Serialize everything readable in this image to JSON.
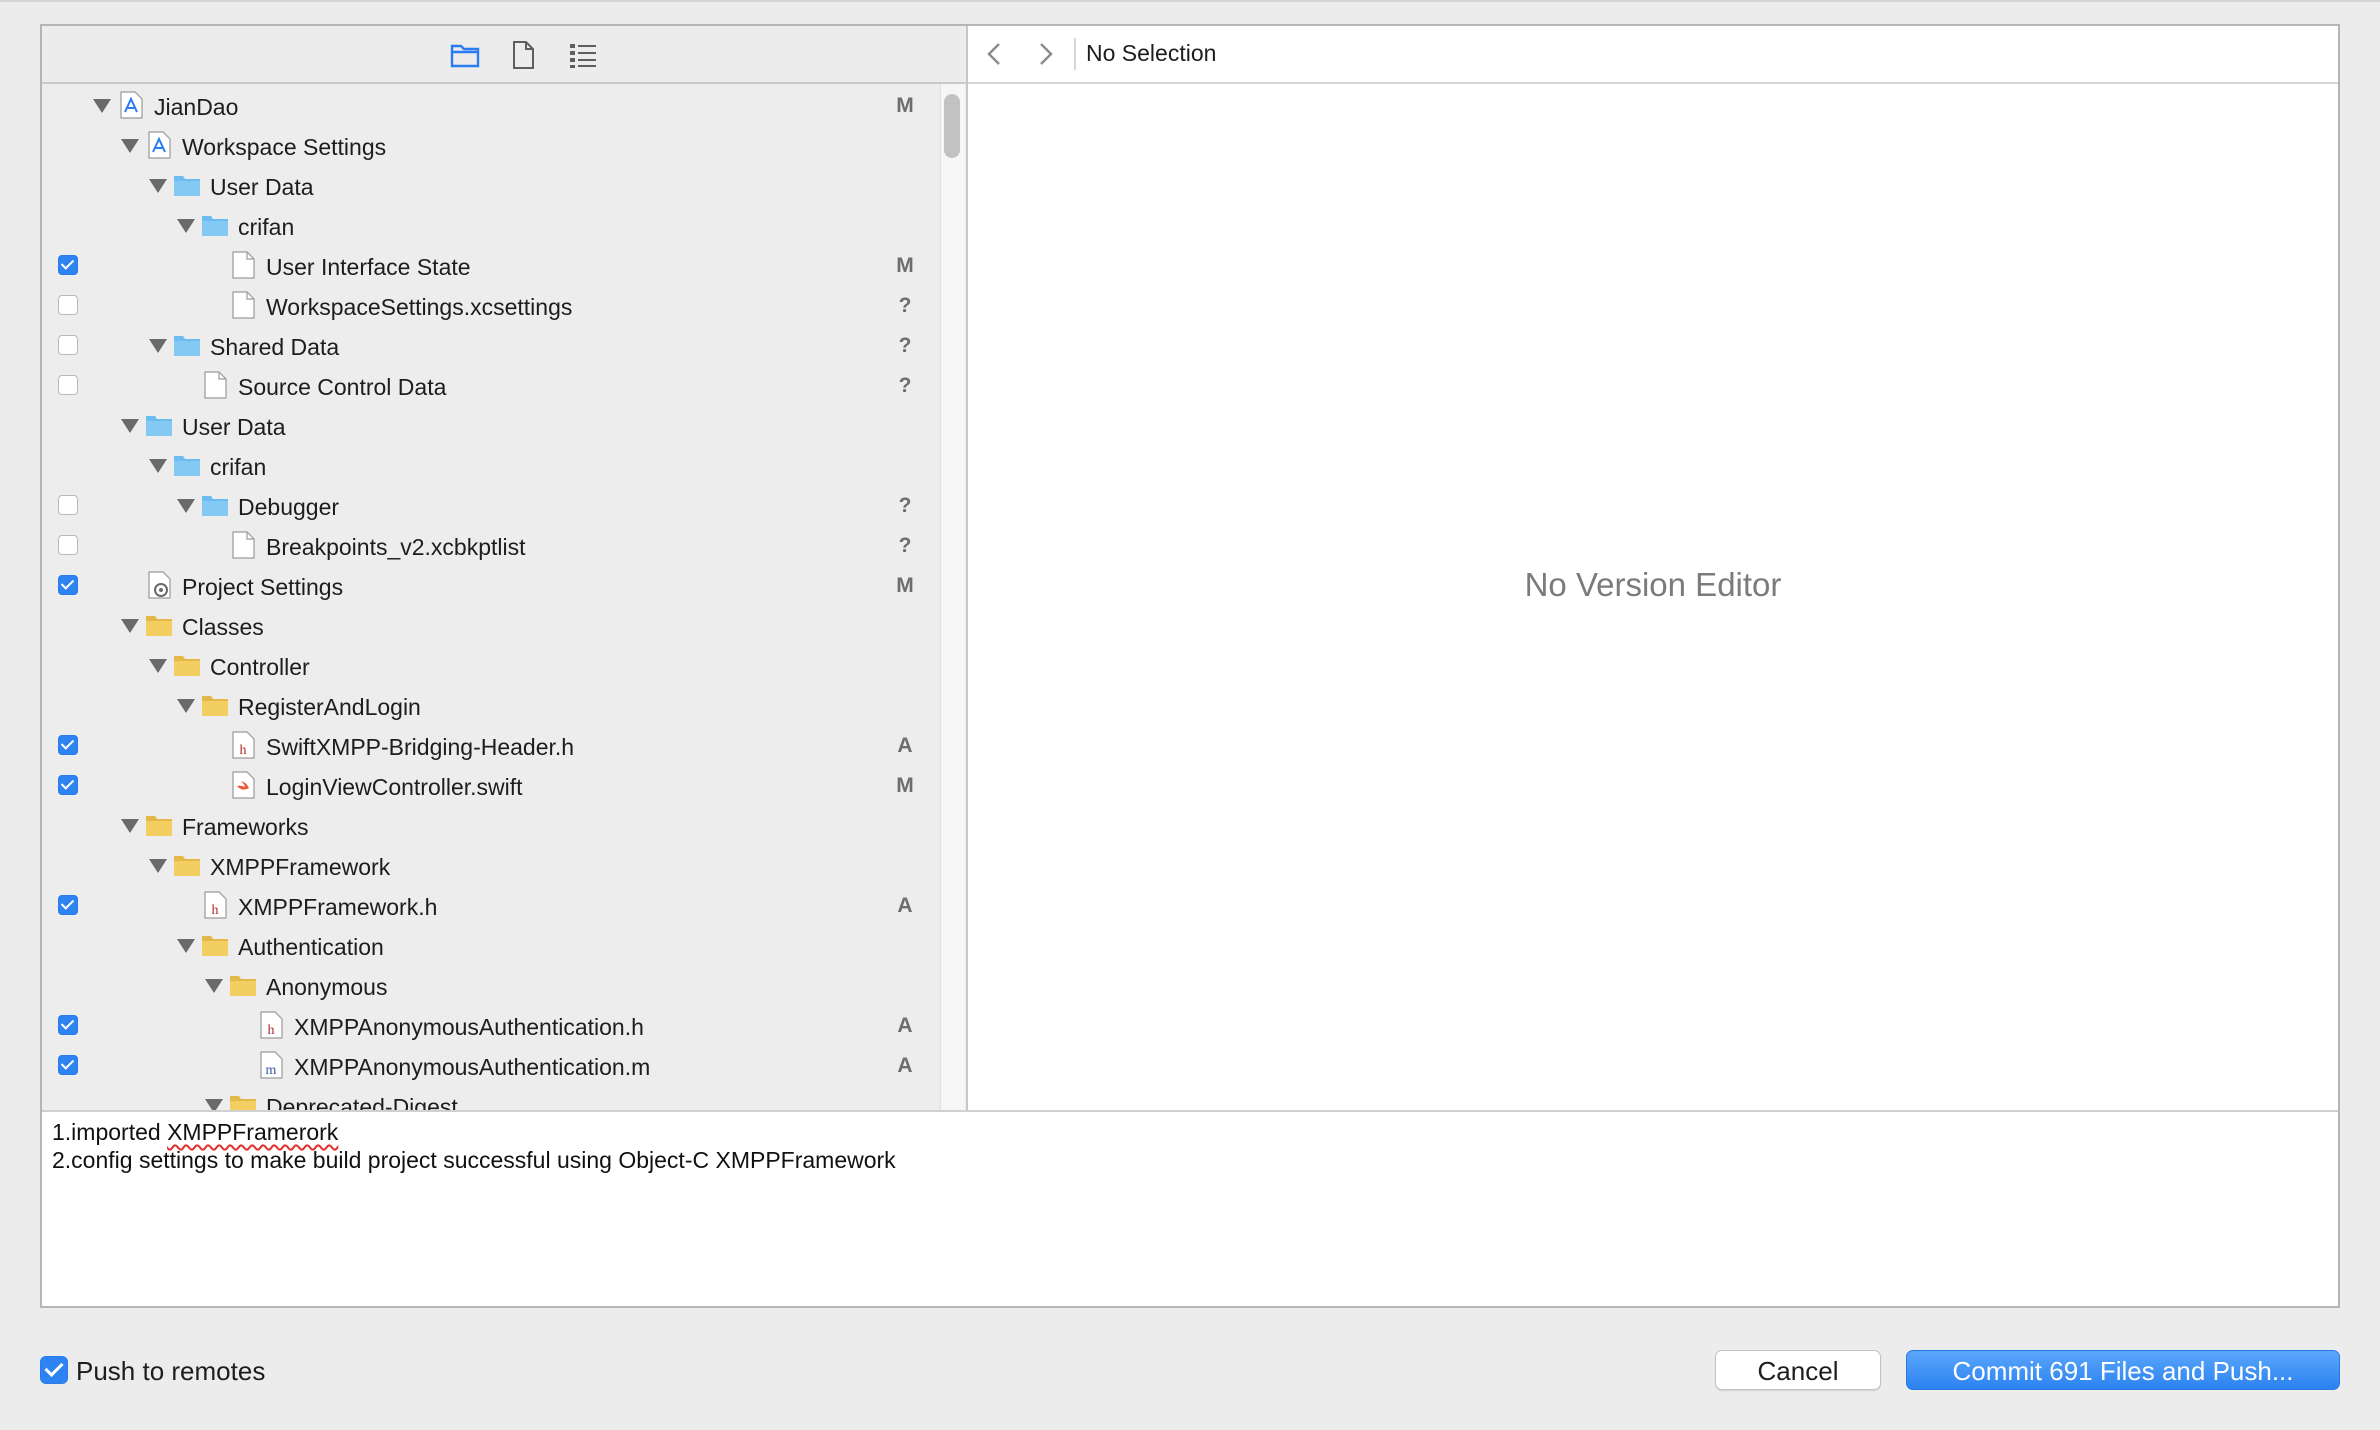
{
  "left_toolbar": {
    "icons": [
      "folder-icon",
      "document-icon",
      "list-icon"
    ]
  },
  "tree": [
    {
      "indent": 0,
      "expanded": true,
      "kind": "xcode-project",
      "label": "JianDao",
      "checkbox": null,
      "status": "M"
    },
    {
      "indent": 1,
      "expanded": true,
      "kind": "xcode-project",
      "label": "Workspace Settings",
      "checkbox": null,
      "status": ""
    },
    {
      "indent": 2,
      "expanded": true,
      "kind": "blue-folder",
      "label": "User Data",
      "checkbox": null,
      "status": ""
    },
    {
      "indent": 3,
      "expanded": true,
      "kind": "blue-folder",
      "label": "crifan",
      "checkbox": null,
      "status": ""
    },
    {
      "indent": 4,
      "expanded": null,
      "kind": "file",
      "label": "User Interface State",
      "checkbox": true,
      "status": "M"
    },
    {
      "indent": 4,
      "expanded": null,
      "kind": "file",
      "label": "WorkspaceSettings.xcsettings",
      "checkbox": false,
      "status": "?"
    },
    {
      "indent": 2,
      "expanded": true,
      "kind": "blue-folder",
      "label": "Shared Data",
      "checkbox": false,
      "status": "?"
    },
    {
      "indent": 3,
      "expanded": null,
      "kind": "file",
      "label": "Source Control Data",
      "checkbox": false,
      "status": "?"
    },
    {
      "indent": 1,
      "expanded": true,
      "kind": "blue-folder",
      "label": "User Data",
      "checkbox": null,
      "status": ""
    },
    {
      "indent": 2,
      "expanded": true,
      "kind": "blue-folder",
      "label": "crifan",
      "checkbox": null,
      "status": ""
    },
    {
      "indent": 3,
      "expanded": true,
      "kind": "blue-folder",
      "label": "Debugger",
      "checkbox": false,
      "status": "?"
    },
    {
      "indent": 4,
      "expanded": null,
      "kind": "file",
      "label": "Breakpoints_v2.xcbkptlist",
      "checkbox": false,
      "status": "?"
    },
    {
      "indent": 1,
      "expanded": null,
      "kind": "settings-file",
      "label": "Project Settings",
      "checkbox": true,
      "status": "M"
    },
    {
      "indent": 1,
      "expanded": true,
      "kind": "yellow-folder",
      "label": "Classes",
      "checkbox": null,
      "status": ""
    },
    {
      "indent": 2,
      "expanded": true,
      "kind": "yellow-folder",
      "label": "Controller",
      "checkbox": null,
      "status": ""
    },
    {
      "indent": 3,
      "expanded": true,
      "kind": "yellow-folder",
      "label": "RegisterAndLogin",
      "checkbox": null,
      "status": ""
    },
    {
      "indent": 4,
      "expanded": null,
      "kind": "h-file",
      "label": "SwiftXMPP-Bridging-Header.h",
      "checkbox": true,
      "status": "A"
    },
    {
      "indent": 4,
      "expanded": null,
      "kind": "swift-file",
      "label": "LoginViewController.swift",
      "checkbox": true,
      "status": "M"
    },
    {
      "indent": 1,
      "expanded": true,
      "kind": "yellow-folder",
      "label": "Frameworks",
      "checkbox": null,
      "status": ""
    },
    {
      "indent": 2,
      "expanded": true,
      "kind": "yellow-folder",
      "label": "XMPPFramework",
      "checkbox": null,
      "status": ""
    },
    {
      "indent": 3,
      "expanded": null,
      "kind": "h-file",
      "label": "XMPPFramework.h",
      "checkbox": true,
      "status": "A"
    },
    {
      "indent": 3,
      "expanded": true,
      "kind": "yellow-folder",
      "label": "Authentication",
      "checkbox": null,
      "status": ""
    },
    {
      "indent": 4,
      "expanded": true,
      "kind": "yellow-folder",
      "label": "Anonymous",
      "checkbox": null,
      "status": ""
    },
    {
      "indent": 5,
      "expanded": null,
      "kind": "h-file",
      "label": "XMPPAnonymousAuthentication.h",
      "checkbox": true,
      "status": "A"
    },
    {
      "indent": 5,
      "expanded": null,
      "kind": "m-file",
      "label": "XMPPAnonymousAuthentication.m",
      "checkbox": true,
      "status": "A"
    },
    {
      "indent": 4,
      "expanded": true,
      "kind": "yellow-folder",
      "label": "Deprecated-Digest",
      "checkbox": null,
      "status": ""
    }
  ],
  "right_bar": {
    "selection": "No Selection",
    "back_icon": "chevron-left-icon",
    "forward_icon": "chevron-right-icon"
  },
  "editor": {
    "placeholder": "No Version Editor"
  },
  "commit_message": {
    "line1_prefix": "1.imported ",
    "line1_misspelled": "XMPPFramerork",
    "line2": "2.config settings to make build project successful using Object-C XMPPFramework"
  },
  "footer": {
    "push_label": "Push to remotes",
    "push_checked": true,
    "cancel_label": "Cancel",
    "commit_label": "Commit 691 Files and Push..."
  },
  "colors": {
    "accent": "#2d83f2",
    "blue_folder": "#6cbcf0",
    "yellow_folder": "#f3cf62",
    "status_text": "#6d6d6d"
  }
}
